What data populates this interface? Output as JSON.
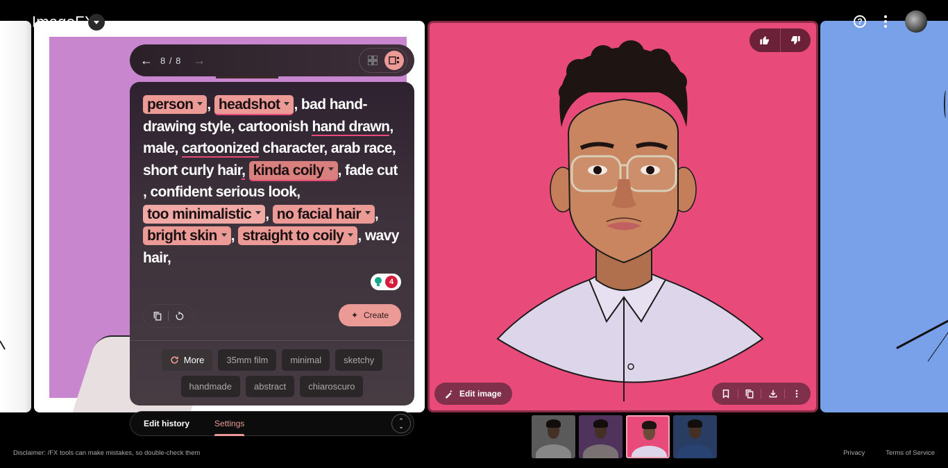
{
  "app": {
    "title": "ImageFX",
    "help_icon": "help-circle-icon",
    "menu_icon": "more-vert-icon",
    "avatar_icon": "user-avatar"
  },
  "navigator": {
    "prev_icon": "arrow-left-icon",
    "counter": "8 / 8",
    "next_icon": "arrow-right-icon",
    "view_modes": [
      "grid-view",
      "single-view"
    ],
    "active_view": "single-view"
  },
  "prompt": {
    "segments": [
      {
        "type": "chip",
        "text": "person",
        "tone": "normal"
      },
      {
        "type": "text",
        "text": ", "
      },
      {
        "type": "chip",
        "text": "headshot",
        "tone": "normal",
        "underline": true
      },
      {
        "type": "text",
        "text": ", bad hand-drawing style, cartoonish "
      },
      {
        "type": "ul",
        "text": "hand drawn"
      },
      {
        "type": "text",
        "text": ", male, "
      },
      {
        "type": "ul",
        "text": "cartoonized"
      },
      {
        "type": "text",
        "text": " character, arab race, short curly hair"
      },
      {
        "type": "ul",
        "text": ","
      },
      {
        "type": "text",
        "text": " "
      },
      {
        "type": "chip",
        "text": "kinda coily",
        "tone": "dark",
        "underline": true
      },
      {
        "type": "text",
        "text": ", fade cut , confident serious look, "
      },
      {
        "type": "chip",
        "text": "too minimalistic",
        "tone": "light"
      },
      {
        "type": "text",
        "text": ", "
      },
      {
        "type": "chip",
        "text": "no facial hair",
        "tone": "normal"
      },
      {
        "type": "text",
        "text": ", "
      },
      {
        "type": "chip",
        "text": "bright skin",
        "tone": "normal"
      },
      {
        "type": "text",
        "text": ", "
      },
      {
        "type": "chip",
        "text": "straight to coily",
        "tone": "normal"
      },
      {
        "type": "text",
        "text": ", wavy hair,"
      }
    ],
    "suggestion_count": "4",
    "copy_icon": "copy-icon",
    "reset_icon": "reset-icon",
    "create_label": "Create",
    "create_icon": "sparkle-icon"
  },
  "suggestions": {
    "more_label": "More",
    "chips": [
      "35mm film",
      "minimal",
      "sketchy",
      "handmade",
      "abstract",
      "chiaroscuro"
    ]
  },
  "tabs": {
    "items": [
      "Edit history",
      "Settings"
    ],
    "active": "Settings"
  },
  "image_actions": {
    "edit_label": "Edit image",
    "like_icon": "thumbs-up-icon",
    "dislike_icon": "thumbs-down-icon",
    "bookmark_icon": "bookmark-icon",
    "copy_icon": "copy-icon",
    "download_icon": "download-icon",
    "more_icon": "more-vert-icon"
  },
  "thumbnails": [
    {
      "bg": "#8a8a8a",
      "body": "#cfcfcf",
      "active": false
    },
    {
      "bg": "#7a4f8f",
      "body": "#bcb0b0",
      "active": false
    },
    {
      "bg": "#e84a7a",
      "body": "#ddd6ea",
      "active": true
    },
    {
      "bg": "#3f5f99",
      "body": "#3e66b0",
      "active": false
    }
  ],
  "colors": {
    "accent": "#eb9a96",
    "pink_bg": "#e84a7a",
    "purple_bg": "#c886cf",
    "blue_bg": "#78a1ea"
  },
  "footer": {
    "disclaimer": "Disclaimer: /FX tools can make mistakes, so double-check them",
    "privacy": "Privacy",
    "terms": "Terms of Service"
  }
}
